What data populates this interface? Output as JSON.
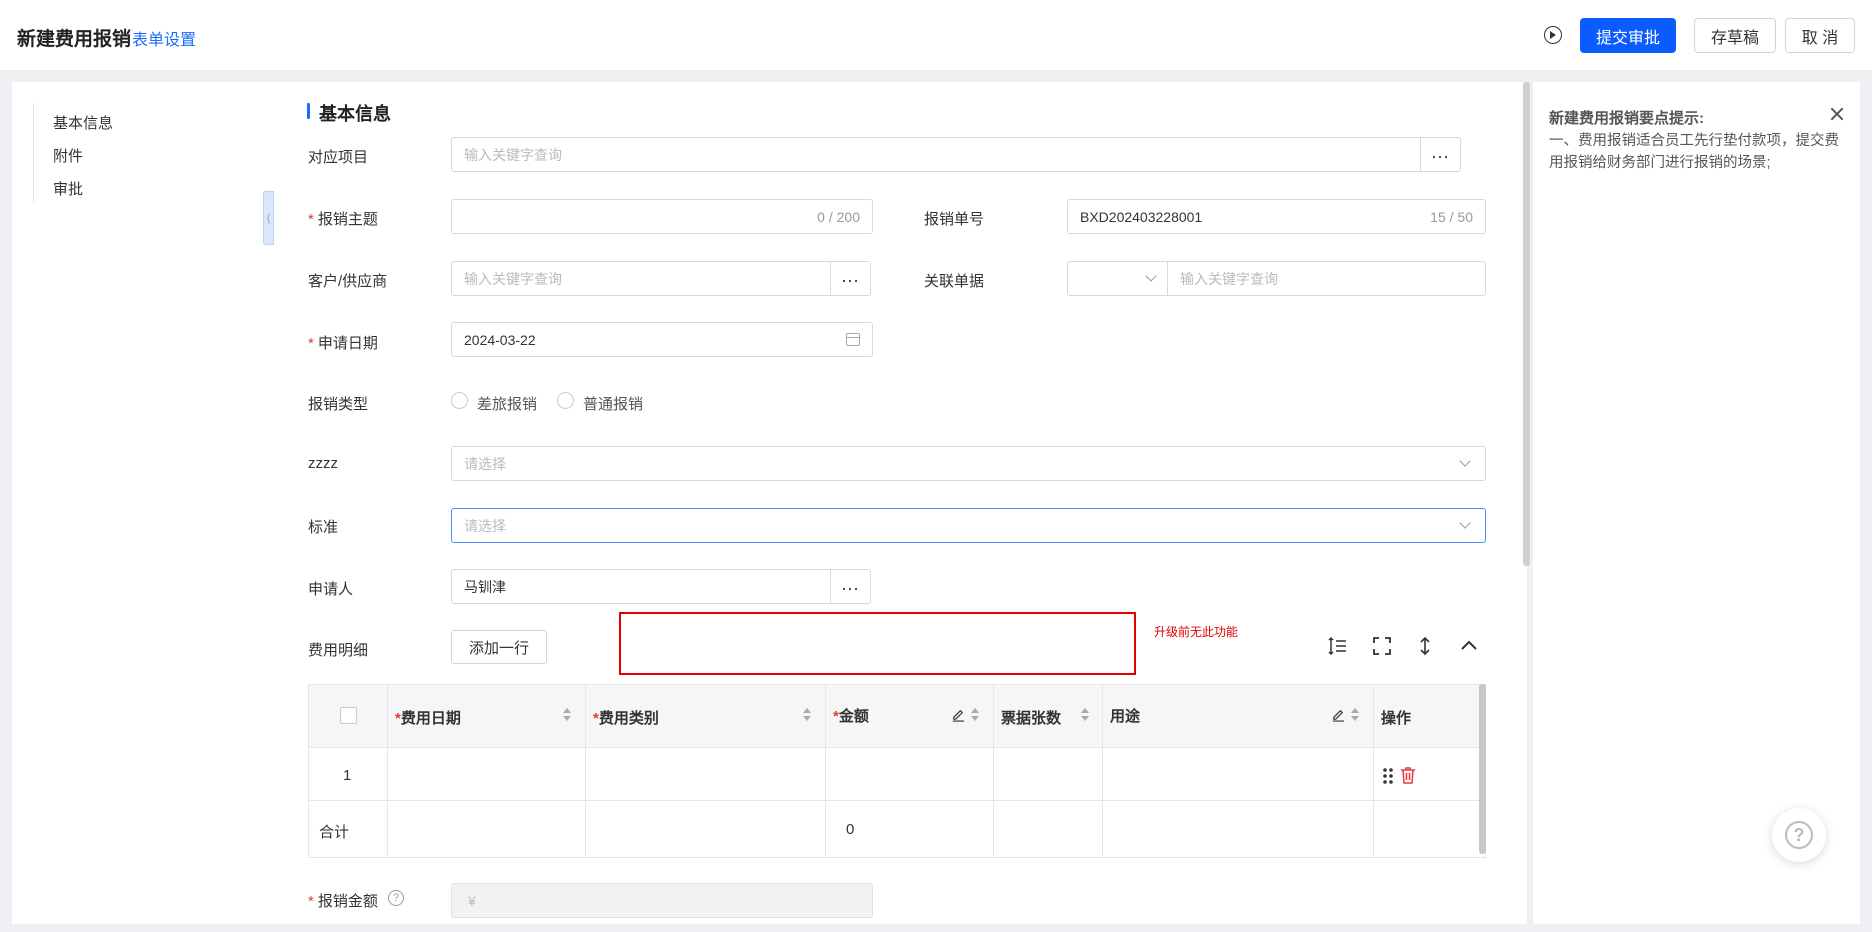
{
  "header": {
    "title": "新建费用报销",
    "form_settings": "表单设置",
    "submit_label": "提交审批",
    "draft_label": "存草稿",
    "cancel_label": "取 消"
  },
  "nav": {
    "items": [
      "基本信息",
      "附件",
      "审批"
    ]
  },
  "form": {
    "section_title": "基本信息",
    "project": {
      "label": "对应项目",
      "placeholder": "输入关键字查询"
    },
    "subject": {
      "label": "报销主题",
      "required": true,
      "counter": "0 / 200"
    },
    "doc_no": {
      "label": "报销单号",
      "value": "BXD202403228001",
      "counter": "15 / 50"
    },
    "customer": {
      "label": "客户/供应商",
      "placeholder": "输入关键字查询"
    },
    "related": {
      "label": "关联单据",
      "placeholder": "输入关键字查询"
    },
    "apply_date": {
      "label": "申请日期",
      "required": true,
      "value": "2024-03-22"
    },
    "expense_type": {
      "label": "报销类型",
      "options": [
        "差旅报销",
        "普通报销"
      ]
    },
    "zzzz": {
      "label": "zzzz",
      "placeholder": "请选择"
    },
    "standard": {
      "label": "标准",
      "placeholder": "请选择"
    },
    "applicant": {
      "label": "申请人",
      "value": "马钏津"
    },
    "details": {
      "label": "费用明细",
      "add_row": "添加一行",
      "note": "升级前无此功能"
    },
    "amount": {
      "label": "报销金额",
      "required": true,
      "placeholder": "¥"
    }
  },
  "table": {
    "columns": [
      "费用日期",
      "费用类别",
      "金额",
      "票据张数",
      "用途",
      "操作"
    ],
    "rows": [
      {
        "index": "1"
      }
    ],
    "total_label": "合计",
    "total_amount": "0"
  },
  "tips": {
    "title": "新建费用报销要点提示:",
    "body": "一、费用报销适合员工先行垫付款项，提交费用报销给财务部门进行报销的场景;"
  },
  "colors": {
    "primary": "#0b5cff",
    "danger": "#e53935",
    "highlight": "#e00000"
  }
}
